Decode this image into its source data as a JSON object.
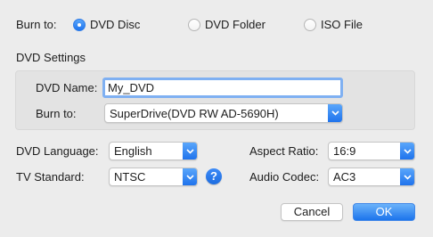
{
  "burn_to": {
    "label": "Burn to:",
    "options": [
      {
        "label": "DVD Disc",
        "selected": true
      },
      {
        "label": "DVD Folder",
        "selected": false
      },
      {
        "label": "ISO File",
        "selected": false
      }
    ]
  },
  "dvd_settings": {
    "heading": "DVD Settings",
    "name_label": "DVD Name:",
    "name_value": "My_DVD",
    "burn_label": "Burn to:",
    "burn_value": "SuperDrive(DVD RW AD-5690H)"
  },
  "options": {
    "language_label": "DVD Language:",
    "language_value": "English",
    "tv_label": "TV Standard:",
    "tv_value": "NTSC",
    "aspect_label": "Aspect Ratio:",
    "aspect_value": "16:9",
    "audio_label": "Audio Codec:",
    "audio_value": "AC3",
    "help": "?"
  },
  "buttons": {
    "cancel": "Cancel",
    "ok": "OK"
  },
  "colors": {
    "accent": "#1e74ec",
    "background": "#ececec",
    "group_background": "#e3e3e3",
    "focus_ring": "#7fb0f2"
  },
  "icons": {
    "select_arrow": "chevron-down-icon",
    "help": "help-icon"
  }
}
